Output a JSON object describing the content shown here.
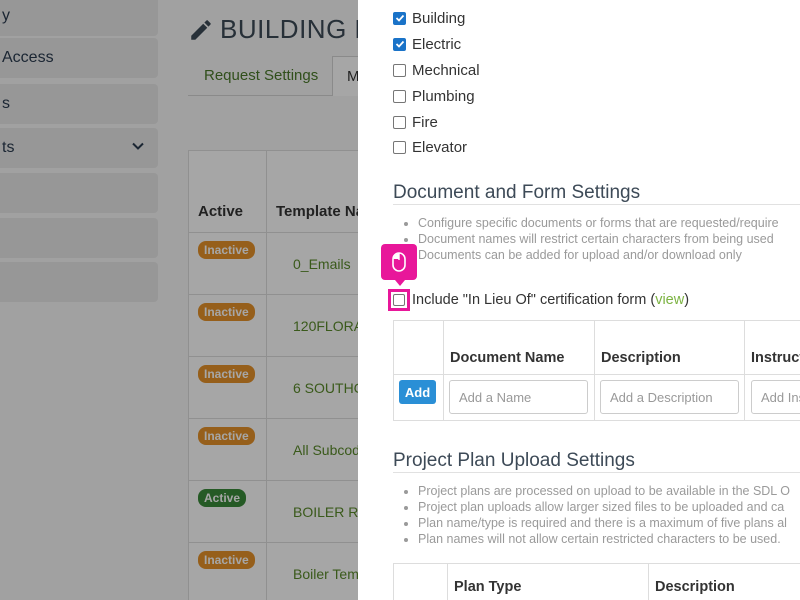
{
  "sidebar": {
    "items": [
      {
        "label": "y",
        "has_chevron": false
      },
      {
        "label": "Access",
        "has_chevron": false
      },
      {
        "label": "s",
        "has_chevron": false
      },
      {
        "label": "ts",
        "has_chevron": true
      },
      {
        "label": "",
        "has_chevron": false
      },
      {
        "label": "",
        "has_chevron": false
      },
      {
        "label": "",
        "has_chevron": false
      }
    ]
  },
  "page": {
    "title": "BUILDING P",
    "title_icon": "pencil-icon",
    "tabs": [
      {
        "label": "Request Settings"
      },
      {
        "label": "M"
      }
    ]
  },
  "templates_table": {
    "headers": [
      "Active",
      "Template Na"
    ],
    "rows": [
      {
        "status": "Inactive",
        "name": "0_Emails"
      },
      {
        "status": "Inactive",
        "name": "120FLORA"
      },
      {
        "status": "Inactive",
        "name": "6 SOUTHC"
      },
      {
        "status": "Inactive",
        "name": "All Subcod"
      },
      {
        "status": "Active",
        "name": "BOILER R"
      },
      {
        "status": "Inactive",
        "name": "Boiler Tem"
      }
    ],
    "status_colors": {
      "Inactive": "#e6932a",
      "Active": "#3a8a3a"
    }
  },
  "modal": {
    "disciplines": [
      {
        "label": "Building",
        "checked": true
      },
      {
        "label": "Electric",
        "checked": true
      },
      {
        "label": "Mechnical",
        "checked": false
      },
      {
        "label": "Plumbing",
        "checked": false
      },
      {
        "label": "Fire",
        "checked": false
      },
      {
        "label": "Elevator",
        "checked": false
      }
    ],
    "document_section": {
      "title": "Document and Form Settings",
      "bullets": [
        "Configure specific documents or forms that are requested/require",
        "Document names will restrict certain characters from being used",
        "Documents can be added for upload and/or download only"
      ],
      "in_lieu": {
        "label": "Include \"In Lieu Of\" certification form (",
        "link": "view",
        "suffix": ")",
        "checked": false
      },
      "cursor_icon": "mouse-icon",
      "table": {
        "headers": [
          "",
          "Document Name",
          "Description",
          "Instruct"
        ],
        "add_label": "Add",
        "name_placeholder": "Add a Name",
        "description_placeholder": "Add a Description",
        "instruction_placeholder": "Add Ins"
      }
    },
    "plan_section": {
      "title": "Project Plan Upload Settings",
      "bullets": [
        "Project plans are processed on upload to be available in the SDL O",
        "Project plan uploads allow larger sized files to be uploaded and ca",
        "Plan name/type is required and there is a maximum of five plans al",
        "Plan names will not allow certain restricted characters to be used."
      ],
      "table": {
        "headers": [
          "",
          "Plan Type",
          "Description"
        ]
      }
    }
  }
}
